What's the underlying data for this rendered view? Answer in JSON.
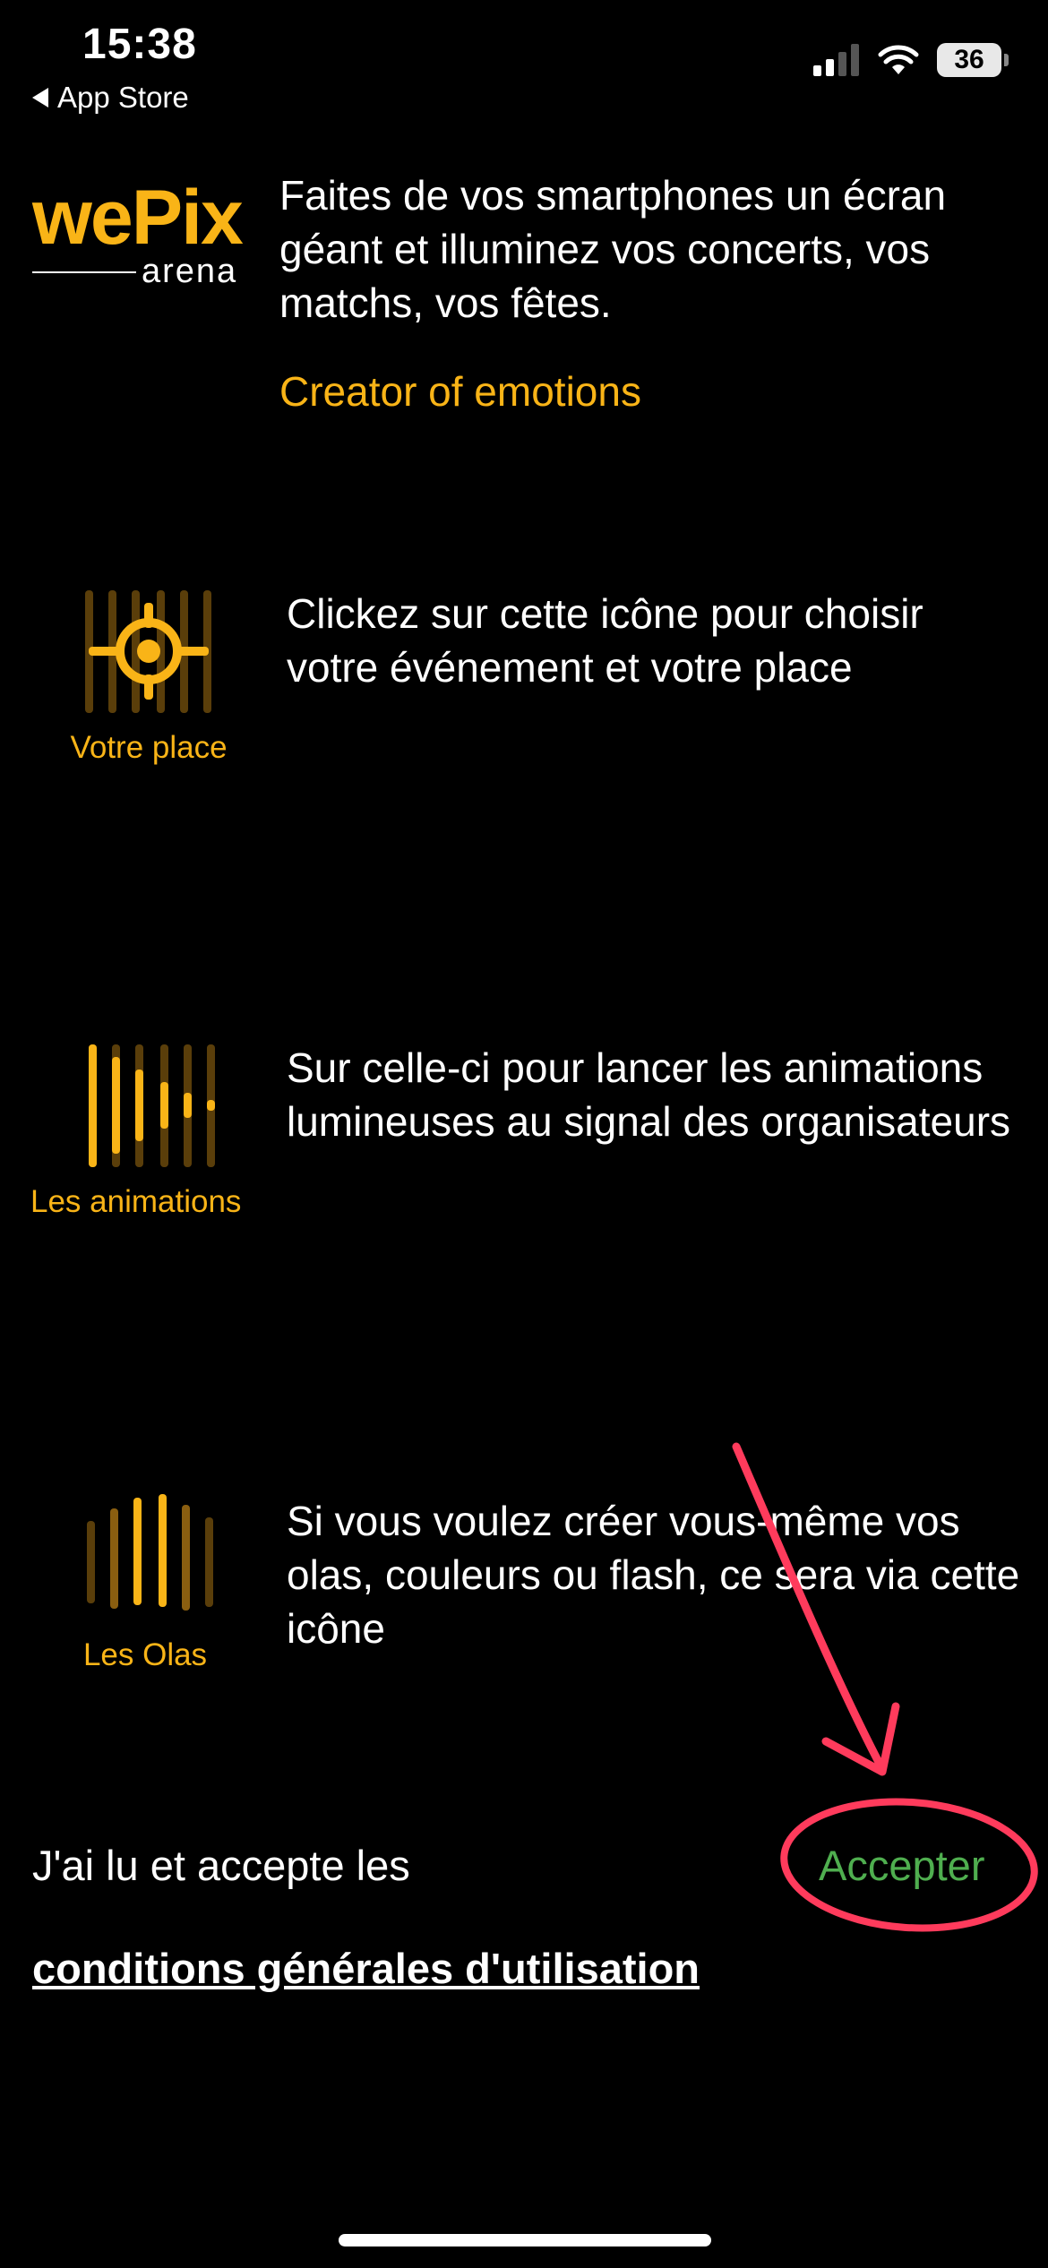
{
  "status_bar": {
    "time": "15:38",
    "back_label": "App Store",
    "battery": "36"
  },
  "logo": {
    "main": "wePix",
    "sub": "arena"
  },
  "intro": {
    "text": "Faites de vos smartphones un écran géant et illuminez vos concerts, vos matchs, vos fêtes.",
    "tagline": "Creator of emotions"
  },
  "features": [
    {
      "label": "Votre place",
      "text": "Clickez sur cette icône pour choisir votre événement et votre place",
      "icon": "target-icon"
    },
    {
      "label": "Les animations",
      "text": "Sur celle-ci pour lancer les animations lumineuses au signal des organisateurs",
      "icon": "bars-animation-icon"
    },
    {
      "label": "Les Olas",
      "text": "Si vous voulez créer vous-même vos olas, couleurs ou flash, ce sera via cette icône",
      "icon": "bars-wave-icon"
    }
  ],
  "acceptance": {
    "text": "J'ai lu et accepte les",
    "button": "Accepter",
    "terms_link": "conditions générales d'utilisation"
  },
  "colors": {
    "brand": "#f9b417",
    "accept": "#4fae4f",
    "annotation": "#ff3b5c"
  }
}
